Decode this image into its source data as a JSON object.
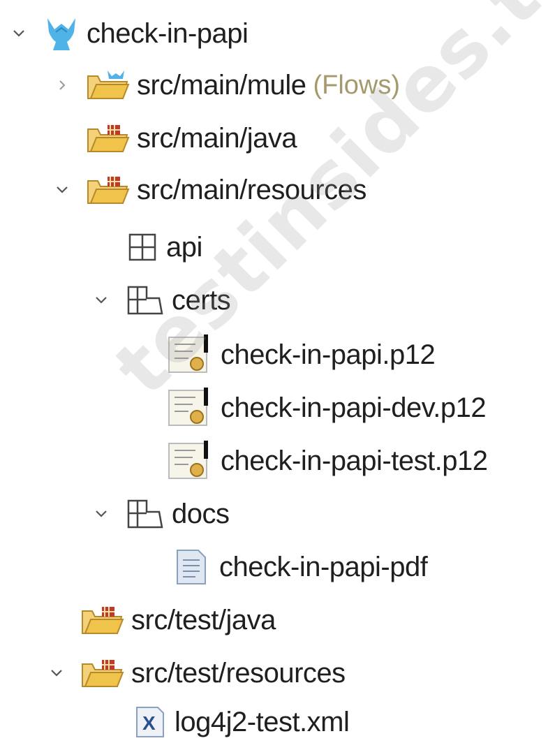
{
  "tree": {
    "project": {
      "label": "check-in-papi",
      "expanded": true
    },
    "items": [
      {
        "label": "src/main/mule",
        "decoration": "(Flows)",
        "expanded": false,
        "icon": "mule-folder-icon"
      },
      {
        "label": "src/main/java",
        "icon": "source-folder-icon"
      },
      {
        "label": "src/main/resources",
        "expanded": true,
        "icon": "source-folder-icon"
      },
      {
        "label": "api",
        "icon": "package-icon"
      },
      {
        "label": "certs",
        "expanded": true,
        "icon": "package-icon"
      },
      {
        "label": "check-in-papi.p12",
        "icon": "certificate-file-icon"
      },
      {
        "label": "check-in-papi-dev.p12",
        "icon": "certificate-file-icon"
      },
      {
        "label": "check-in-papi-test.p12",
        "icon": "certificate-file-icon"
      },
      {
        "label": "docs",
        "expanded": true,
        "icon": "package-icon"
      },
      {
        "label": "check-in-papi-pdf",
        "icon": "text-file-icon"
      },
      {
        "label": "src/test/java",
        "icon": "source-folder-icon"
      },
      {
        "label": "src/test/resources",
        "expanded": true,
        "icon": "source-folder-icon"
      },
      {
        "label": "log4j2-test.xml",
        "icon": "xml-file-icon"
      }
    ]
  },
  "watermark": "testinsides.top",
  "colors": {
    "folder": "#f0c34a",
    "mule": "#4fb3e8",
    "decoration": "#a59a6d"
  }
}
